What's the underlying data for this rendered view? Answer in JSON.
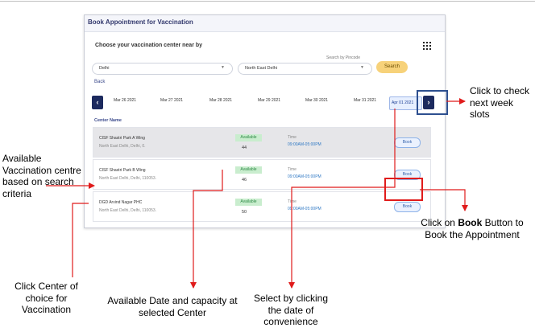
{
  "panel": {
    "title": "Book Appointment for Vaccination",
    "choose_label": "Choose your vaccination center near by",
    "search_by_pincode": "Search by Pincode",
    "state_value": "Delhi",
    "district_value": "North East Delhi",
    "search_label": "Search",
    "back_label": "Back",
    "center_name_header": "Center Name"
  },
  "dates": [
    "Mar 26 2021",
    "Mar 27 2021",
    "Mar 28 2021",
    "Mar 29 2021",
    "Mar 30 2021",
    "Mar 31 2021"
  ],
  "selected_date": "Apr 01 2021",
  "centers": [
    {
      "name": "CISF Shastri Park A Wing",
      "address": "North East Delhi, Delhi, 0.",
      "status": "Available",
      "capacity": "44",
      "time_label": "Time",
      "time": "09:00AM-05:00PM",
      "book": "Book"
    },
    {
      "name": "CISF Shastri Park B Wing",
      "address": "North East Delhi, Delhi, 110053.",
      "status": "Available",
      "capacity": "46",
      "time_label": "Time",
      "time": "09:00AM-05:00PM",
      "book": "Book"
    },
    {
      "name": "DGD Arvind Nagar PHC",
      "address": "North East Delhi, Delhi, 110053.",
      "status": "Available",
      "capacity": "50",
      "time_label": "Time",
      "time": "09:00AM-05:00PM",
      "book": "Book"
    }
  ],
  "annotations": {
    "next_week": "Click to check next week slots",
    "available_centre": "Available Vaccination centre based on search criteria",
    "book_prefix": "Click on ",
    "book_bold": "Book",
    "book_suffix": " Button to Book the Appointment",
    "click_center": "Click Center of choice for Vaccination",
    "date_capacity": "Available Date and capacity at selected Center",
    "select_date": "Select by clicking the date of convenience"
  },
  "colors": {
    "accent_navy": "#1c2a5e",
    "annotation_red": "#e01b1b",
    "highlight_blue": "#2d4f8f",
    "search_button": "#f7d27a",
    "available_green": "#c9edce"
  }
}
